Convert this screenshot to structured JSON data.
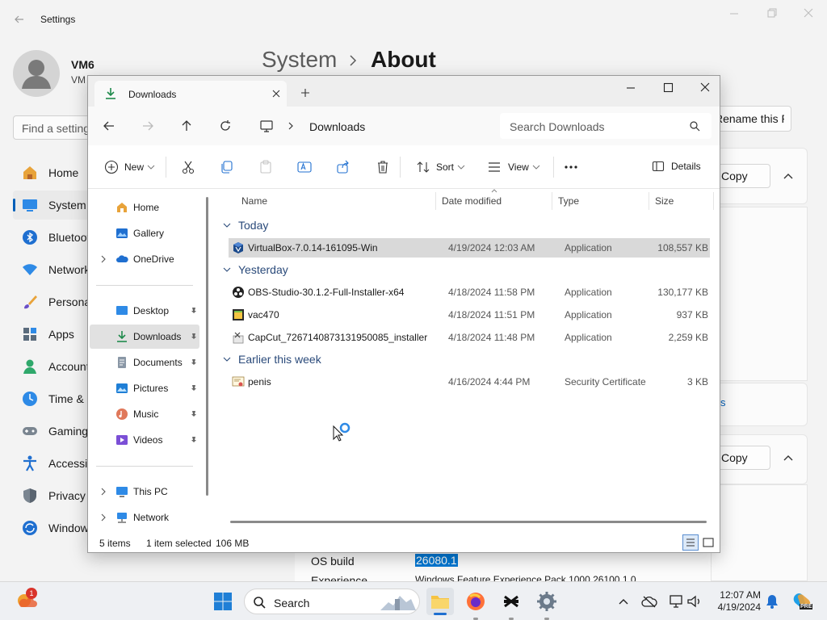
{
  "settings": {
    "title": "Settings",
    "user_name": "VM6",
    "user_sub": "VM",
    "search_placeholder": "Find a setting",
    "breadcrumb": {
      "parent": "System",
      "current": "About"
    },
    "nav": [
      {
        "label": "Home",
        "icon": "home-icon"
      },
      {
        "label": "System",
        "icon": "system-icon",
        "selected": true
      },
      {
        "label": "Bluetooth",
        "icon": "bluetooth-icon"
      },
      {
        "label": "Network",
        "icon": "network-icon"
      },
      {
        "label": "Personalization",
        "icon": "brush-icon"
      },
      {
        "label": "Apps",
        "icon": "apps-icon"
      },
      {
        "label": "Accounts",
        "icon": "accounts-icon"
      },
      {
        "label": "Time & language",
        "icon": "clock-icon"
      },
      {
        "label": "Gaming",
        "icon": "gamepad-icon"
      },
      {
        "label": "Accessibility",
        "icon": "accessibility-icon"
      },
      {
        "label": "Privacy",
        "icon": "shield-icon"
      },
      {
        "label": "Windows Update",
        "icon": "update-icon"
      }
    ],
    "rename_button": "Rename this PC",
    "copy_button_1": "Copy",
    "copy_button_2": "Copy",
    "link_fragment": "s",
    "os_build_label": "OS build",
    "os_build_value": "26080.1",
    "experience_label": "Experience",
    "experience_value": "Windows Feature Experience Pack 1000.26100.1.0"
  },
  "explorer": {
    "tab_title": "Downloads",
    "address": "Downloads",
    "search_placeholder": "Search Downloads",
    "commands": {
      "new": "New",
      "sort": "Sort",
      "view": "View",
      "details": "Details"
    },
    "sidebar": [
      {
        "label": "Home",
        "icon": "home-icon"
      },
      {
        "label": "Gallery",
        "icon": "gallery-icon"
      },
      {
        "label": "OneDrive",
        "icon": "onedrive-icon",
        "expandable": true
      },
      {
        "label": "Desktop",
        "icon": "desktop-icon",
        "pinned": true
      },
      {
        "label": "Downloads",
        "icon": "download-icon",
        "pinned": true,
        "selected": true
      },
      {
        "label": "Documents",
        "icon": "documents-icon",
        "pinned": true
      },
      {
        "label": "Pictures",
        "icon": "pictures-icon",
        "pinned": true
      },
      {
        "label": "Music",
        "icon": "music-icon",
        "pinned": true
      },
      {
        "label": "Videos",
        "icon": "videos-icon",
        "pinned": true
      },
      {
        "label": "This PC",
        "icon": "pc-icon",
        "expandable": true
      },
      {
        "label": "Network",
        "icon": "network-icon",
        "expandable": true
      }
    ],
    "columns": {
      "name": "Name",
      "date": "Date modified",
      "type": "Type",
      "size": "Size"
    },
    "groups": [
      {
        "label": "Today",
        "files": [
          {
            "name": "VirtualBox-7.0.14-161095-Win",
            "date": "4/19/2024 12:03 AM",
            "type": "Application",
            "size": "108,557 KB",
            "icon": "virtualbox-icon",
            "selected": true
          }
        ]
      },
      {
        "label": "Yesterday",
        "files": [
          {
            "name": "OBS-Studio-30.1.2-Full-Installer-x64",
            "date": "4/18/2024 11:58 PM",
            "type": "Application",
            "size": "130,177 KB",
            "icon": "obs-icon"
          },
          {
            "name": "vac470",
            "date": "4/18/2024 11:51 PM",
            "type": "Application",
            "size": "937 KB",
            "icon": "installer-icon"
          },
          {
            "name": "CapCut_7267140873131950085_installer",
            "date": "4/18/2024 11:48 PM",
            "type": "Application",
            "size": "2,259 KB",
            "icon": "capcut-icon"
          }
        ]
      },
      {
        "label": "Earlier this week",
        "files": [
          {
            "name": "penis",
            "date": "4/16/2024 4:44 PM",
            "type": "Security Certificate",
            "size": "3 KB",
            "icon": "certificate-icon"
          }
        ]
      }
    ],
    "status": {
      "items": "5 items",
      "selection": "1 item selected",
      "size": "106 MB"
    }
  },
  "taskbar": {
    "search_placeholder": "Search",
    "notification_badge": "1",
    "time": "12:07 AM",
    "date": "4/19/2024",
    "copilot_badge": "PRE"
  },
  "colors": {
    "accent": "#0078d4",
    "folder": "#f6c342",
    "selection": "#d9d9d9"
  }
}
